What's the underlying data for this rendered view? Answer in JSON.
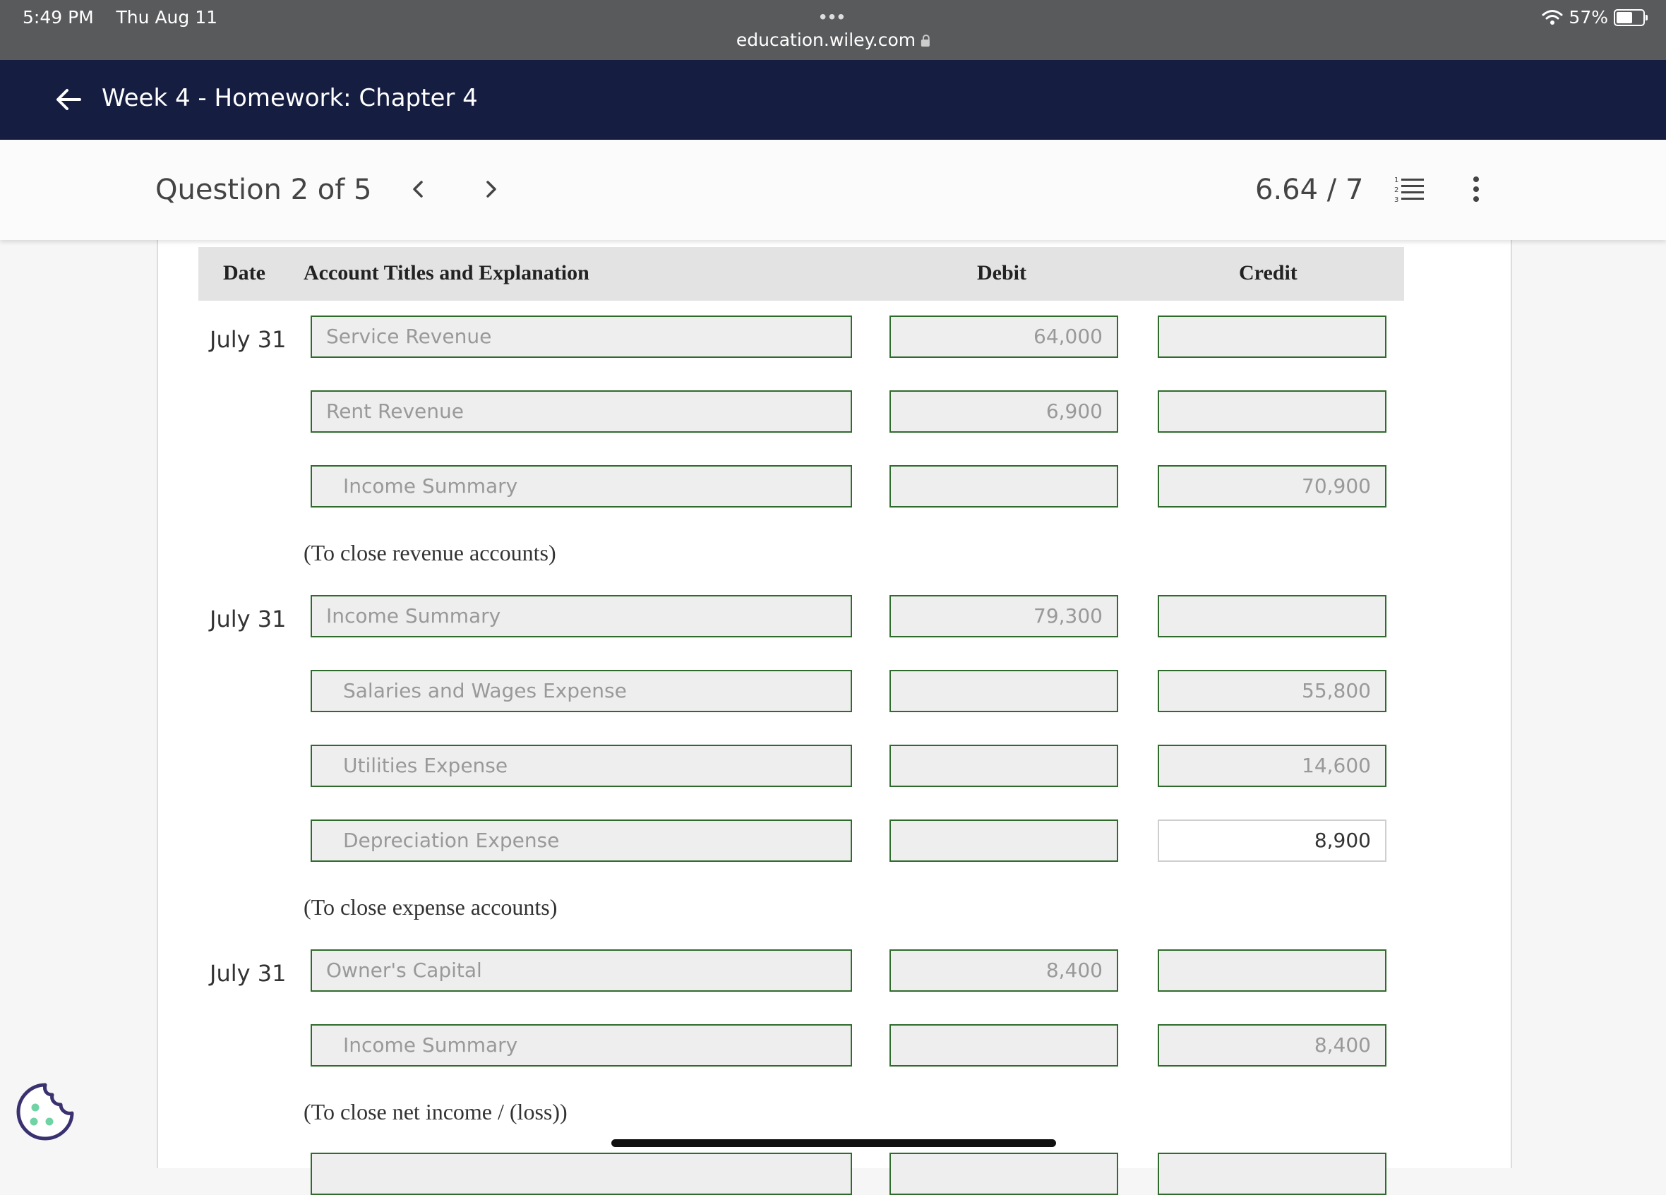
{
  "status_bar": {
    "time": "5:49 PM",
    "date": "Thu Aug 11",
    "dots": "•••",
    "url": "education.wiley.com",
    "battery": "57%"
  },
  "nav": {
    "title": "Week 4 - Homework: Chapter 4"
  },
  "question": {
    "label": "Question 2 of 5",
    "score": "6.64 / 7"
  },
  "table": {
    "headers": {
      "date": "Date",
      "account": "Account Titles and Explanation",
      "debit": "Debit",
      "credit": "Credit"
    },
    "entries": [
      {
        "date": "July 31",
        "lines": [
          {
            "account": "Service Revenue",
            "debit": "64,000",
            "credit": ""
          },
          {
            "account": "Rent Revenue",
            "debit": "6,900",
            "credit": ""
          },
          {
            "account": "Income Summary",
            "debit": "",
            "credit": "70,900"
          }
        ],
        "explanation": "(To close revenue accounts)"
      },
      {
        "date": "July 31",
        "lines": [
          {
            "account": "Income Summary",
            "debit": "79,300",
            "credit": ""
          },
          {
            "account": "Salaries and Wages Expense",
            "debit": "",
            "credit": "55,800"
          },
          {
            "account": "Utilities Expense",
            "debit": "",
            "credit": "14,600"
          },
          {
            "account": "Depreciation Expense",
            "debit": "",
            "credit": "8,900"
          }
        ],
        "explanation": "(To close expense accounts)"
      },
      {
        "date": "July 31",
        "lines": [
          {
            "account": "Owner's Capital",
            "debit": "8,400",
            "credit": ""
          },
          {
            "account": "Income Summary",
            "debit": "",
            "credit": "8,400"
          }
        ],
        "explanation": "(To close net income / (loss))"
      }
    ]
  },
  "colors": {
    "nav_bg": "#151d41",
    "status_bg": "#595a5c",
    "field_border": "#2f6b2c",
    "header_bg": "#e3e3e3"
  }
}
